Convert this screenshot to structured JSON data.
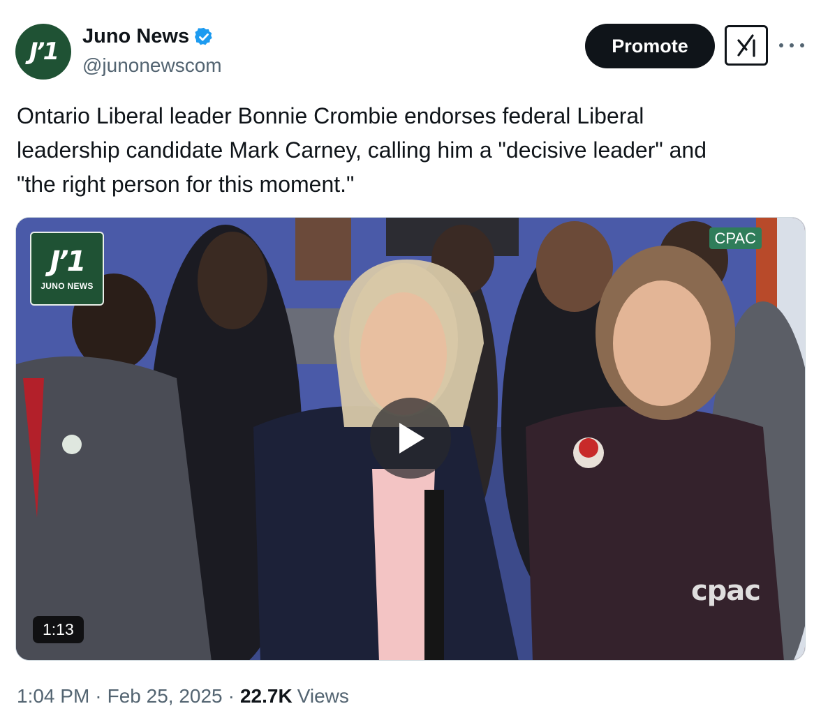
{
  "account": {
    "avatar_text": "Jʼ1",
    "name": "Juno News",
    "handle": "@junonewscom",
    "verified": true
  },
  "actions": {
    "promote_label": "Promote",
    "grok_icon": "grok-icon",
    "more_icon": "more-options-icon"
  },
  "tweet": {
    "text": "Ontario Liberal leader Bonnie Crombie endorses federal Liberal\nleadership candidate Mark Carney, calling him a \"decisive leader\" and\n\"the right person for this moment.\""
  },
  "video": {
    "logo_mark": "Jʼ1",
    "logo_text": "JUNO NEWS",
    "channel_tag": "CPAC",
    "channel_bug": "cpac",
    "duration": "1:13",
    "play_icon": "play-icon"
  },
  "meta": {
    "time": "1:04 PM",
    "separator": "·",
    "date": "Feb 25, 2025",
    "views_count": "22.7K",
    "views_label": "Views"
  },
  "colors": {
    "brand_green": "#1f5234",
    "verified_blue": "#1d9bf0",
    "text_primary": "#0f1419",
    "text_secondary": "#536471"
  }
}
